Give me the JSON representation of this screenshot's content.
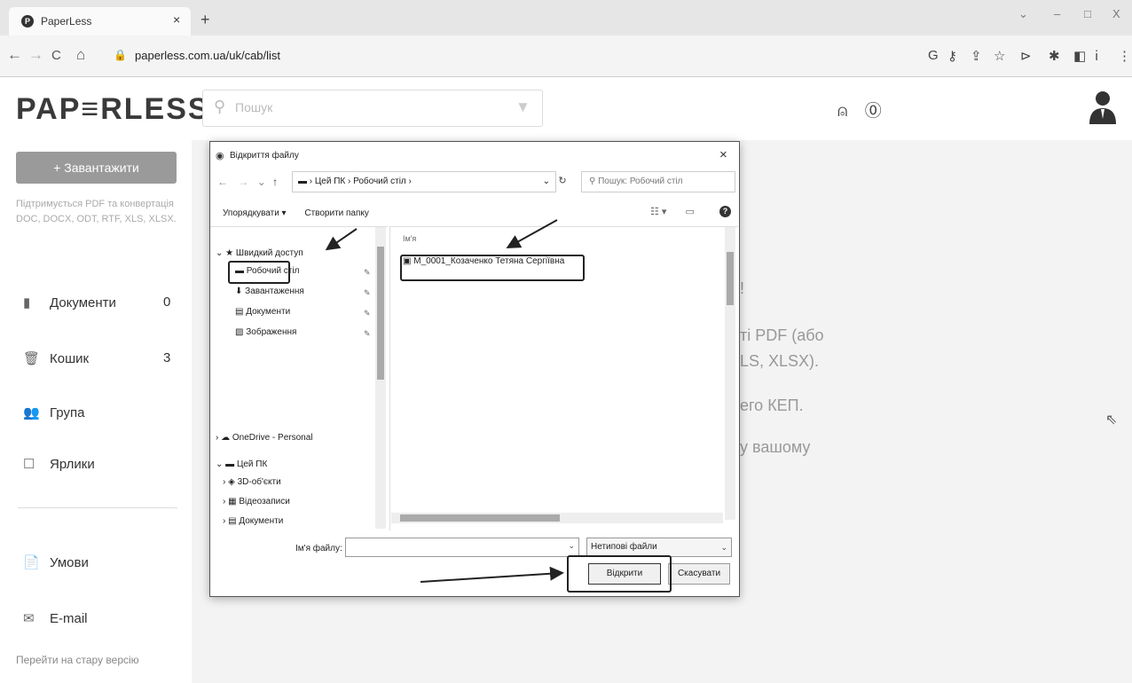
{
  "browser": {
    "tab_title": "PaperLess",
    "tab_close": "×",
    "new_tab": "+",
    "url": "paperless.com.ua/uk/cab/list",
    "nav": {
      "back": "←",
      "forward": "→",
      "reload": "C",
      "home": "⌂"
    },
    "window_controls": {
      "dropdown": "⌄",
      "minimize": "–",
      "maximize": "□",
      "close": "X"
    }
  },
  "app": {
    "logo": "PAP≡RLESS",
    "search_placeholder": "Пошук",
    "upload_button": "+ Завантажити",
    "support_text": "Підтримується PDF та конвертація DOC, DOCX, ODT, RTF, XLS, XLSX.",
    "menu": [
      {
        "label": "Документи",
        "count": "0",
        "icon": "document-icon"
      },
      {
        "label": "Кошик",
        "count": "3",
        "icon": "trash-icon"
      },
      {
        "label": "Група",
        "count": "",
        "icon": "group-icon"
      },
      {
        "label": "Ярлики",
        "count": "",
        "icon": "bookmark-icon"
      }
    ],
    "bottom_menu": [
      {
        "label": "Умови",
        "icon": "terms-icon"
      },
      {
        "label": "E-mail",
        "icon": "mail-icon"
      }
    ],
    "old_version_link": "Перейти на стару версію",
    "background_text": {
      "line1": "!",
      "line2": "ті PDF (або",
      "line3": "LS, XLSX).",
      "line4": "его КЕП.",
      "line5": "у вашому"
    }
  },
  "dialog": {
    "title": "Відкриття файлу",
    "close": "×",
    "breadcrumb": "›  Цей ПК  ›  Робочий стіл  ›",
    "search_placeholder": "Пошук: Робочий стіл",
    "toolbar": {
      "organize": "Упорядкувати ▾",
      "new_folder": "Створити папку"
    },
    "quick_access": "Швидкий доступ",
    "nav_items": [
      "Робочий стіл",
      "Завантаження",
      "Документи",
      "Зображення"
    ],
    "onedrive": "OneDrive - Personal",
    "this_pc": "Цей ПК",
    "pc_items": [
      "3D-об'єкти",
      "Відеозаписи",
      "Документи"
    ],
    "column_header": "Ім'я",
    "file_name": "M_0001_Козаченко Тетяна Сергіївна",
    "filename_label": "Ім'я файлу:",
    "filename_value": "",
    "filetype": "Нетипові файли",
    "open_button": "Відкрити",
    "cancel_button": "Скасувати"
  }
}
